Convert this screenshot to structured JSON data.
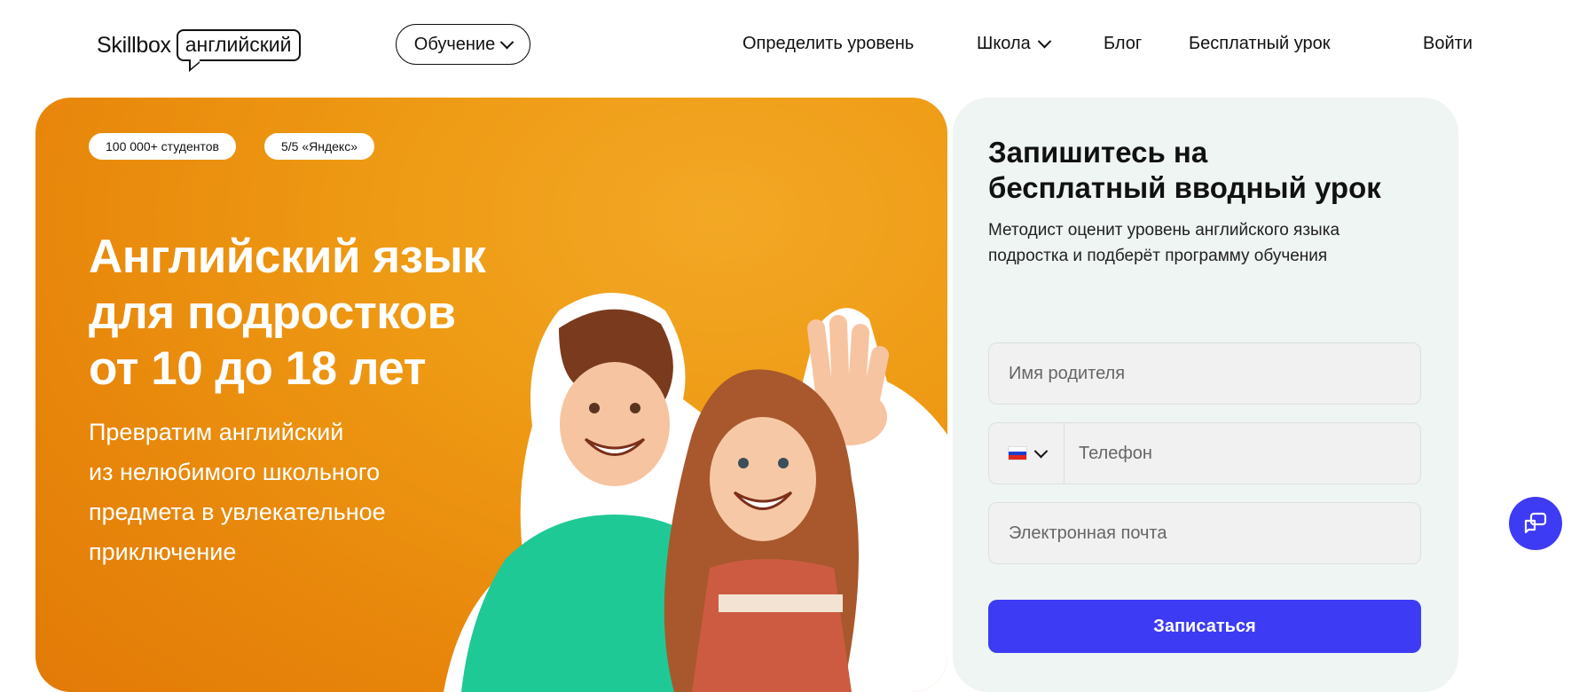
{
  "header": {
    "logo_text": "Skillbox",
    "logo_badge": "английский",
    "education_button": "Обучение",
    "nav": {
      "level": "Определить уровень",
      "school": "Школа",
      "blog": "Блог",
      "free_lesson": "Бесплатный урок",
      "login": "Войти"
    }
  },
  "hero": {
    "badges": [
      "100 000+ студентов",
      "5/5 «Яндекс»"
    ],
    "title_lines": [
      "Английский язык",
      "для подростков",
      "от 10 до 18 лет"
    ],
    "subtitle_lines": [
      "Превратим английский",
      "из нелюбимого школьного",
      "предмета в увлекательное",
      "приключение"
    ]
  },
  "form": {
    "title_lines": [
      "Запишитесь на",
      "бесплатный вводный урок"
    ],
    "description_lines": [
      "Методист оценит уровень английского языка",
      "подростка и подберёт программу обучения"
    ],
    "parent_name_placeholder": "Имя родителя",
    "phone_placeholder": "Телефон",
    "email_placeholder": "Электронная почта",
    "submit_label": "Записаться"
  },
  "colors": {
    "accent": "#3e3bf5",
    "hero_orange": "#ee9a14",
    "form_bg": "#eef5f3"
  },
  "icons": {
    "chat": "chat-bubbles-icon",
    "country_flag": "russia-flag-icon",
    "dropdown": "chevron-down-icon"
  }
}
